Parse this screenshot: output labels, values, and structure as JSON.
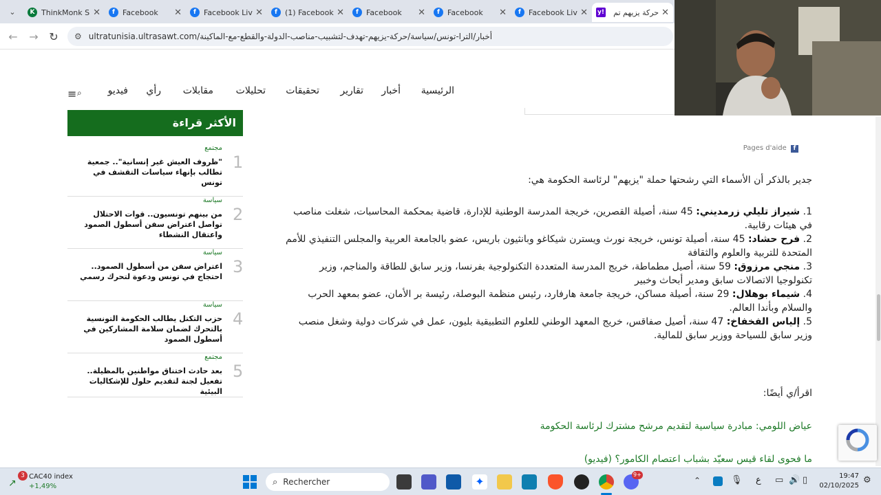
{
  "browser": {
    "tabs": [
      {
        "title": "ThinkMonk S",
        "icon": "k-logo-icon",
        "color": "#0a7a3c"
      },
      {
        "title": "Facebook",
        "icon": "facebook-icon",
        "color": "#1877f2"
      },
      {
        "title": "Facebook Liv",
        "icon": "facebook-icon",
        "color": "#1877f2"
      },
      {
        "title": "(1) Facebook",
        "icon": "facebook-icon",
        "color": "#1877f2"
      },
      {
        "title": "Facebook",
        "icon": "facebook-icon",
        "color": "#1877f2"
      },
      {
        "title": "Facebook",
        "icon": "facebook-icon",
        "color": "#1877f2"
      },
      {
        "title": "Facebook Liv",
        "icon": "facebook-icon",
        "color": "#1877f2"
      },
      {
        "title": "حركة يزيهم تم",
        "icon": "yahoo-icon",
        "color": "#6001d2"
      }
    ],
    "url": "ultratunisia.ultrasawt.com/أخبار/الترا-تونس/سياسة/حركة-يزيهم-تهدف-لتشبيب-مناصب-الدولة-والقطع-مع-الماكينة"
  },
  "site_nav": [
    "الرئيسية",
    "أخبار",
    "تقارير",
    "تحقيقات",
    "تحليلات",
    "مقابلات",
    "رأي",
    "فيديو"
  ],
  "sidebar": {
    "heading": "الأكثر قراءة",
    "items": [
      {
        "num": "1",
        "category": "مجتمع",
        "title": "\"ظروف العيش غير إنسانية\".. جمعية تطالب بإنهاء سياسات التقشف في تونس"
      },
      {
        "num": "2",
        "category": "سياسة",
        "title": "من بينهم تونسيون.. قوات الاحتلال تواصل اعتراض سفن أسطول الصمود واعتقال النشطاء"
      },
      {
        "num": "3",
        "category": "سياسة",
        "title": "اعتراض سفن من أسطول الصمود.. احتجاج في تونس ودعوة لتحرك رسمي"
      },
      {
        "num": "4",
        "category": "سياسة",
        "title": "حزب التكتل يطالب الحكومة التونسية بالتحرك لضمان سلامة المشاركين في أسطول الصمود"
      },
      {
        "num": "5",
        "category": "مجتمع",
        "title": "بعد حادث اختناق مواطنين بالمظيلة.. تفعيل لجنة لتقديم حلول للإشكاليات البيئية"
      }
    ]
  },
  "article": {
    "fb_help": "Pages d'aide",
    "intro": "جدير بالذكر أن الأسماء التي رشحتها حملة \"يزيهم\" لرئاسة الحكومة هي:",
    "list": [
      {
        "num": "1.",
        "name": "شيراز تليلي زرمديني:",
        "text": " 45 سنة، أصيلة القصرين، خريجة المدرسة الوطنية للإدارة، قاضية بمحكمة المحاسبات، شغلت مناصب في هيئات رقابية."
      },
      {
        "num": "2.",
        "name": "فرح حشاد:",
        "text": " 45 سنة، أصيلة تونس، خريجة نورث ويسترن شيكاغو وبانثيون باريس، عضو بالجامعة العربية والمجلس التنفيذي للأمم المتحدة للتربية والعلوم والثقافة"
      },
      {
        "num": "3.",
        "name": "منجي مرزوق:",
        "text": " 59 سنة، أصيل مطماطة، خريج المدرسة المتعددة التكنولوجية بفرنسا، وزير سابق للطاقة والمناجم، وزير تكنولوجيا الاتصالات سابق ومدير أبحاث وخبير"
      },
      {
        "num": "4.",
        "name": "شيماء بوهلال:",
        "text": " 29 سنة، أصيلة مساكن، خريجة جامعة هارفارد، رئيس منظمة البوصلة، رئيسة بر الأمان، عضو بمعهد الحرب والسلام وبأندا العالم."
      },
      {
        "num": "5.",
        "name": "إلياس الفخفاخ:",
        "text": " 47 سنة، أصيل صفاقس، خريج المعهد الوطني للعلوم التطبيقية بليون، عمل في شركات دولية وشغل منصب وزير سابق للسياحة ووزير سابق للمالية."
      }
    ],
    "read_also": "اقرأ/ي أيضًا:",
    "related": [
      "عياض اللومي: مبادرة سياسية لتقديم مرشح مشترك لرئاسة الحكومة",
      "ما فحوى لقاء قيس سعيّد بشباب اعتصام الكامور؟ (فيديو)"
    ]
  },
  "taskbar": {
    "widget_badge": "3",
    "widget_title": "CAC40 index",
    "widget_value": "+1,49%",
    "search_placeholder": "Rechercher",
    "lang": "ع",
    "time": "19:47",
    "date": "02/10/2025",
    "discord_badge": "9+"
  },
  "colors": {
    "brand_green": "#156d1e",
    "link_green": "#1e7a28",
    "facebook_blue": "#1877f2"
  }
}
